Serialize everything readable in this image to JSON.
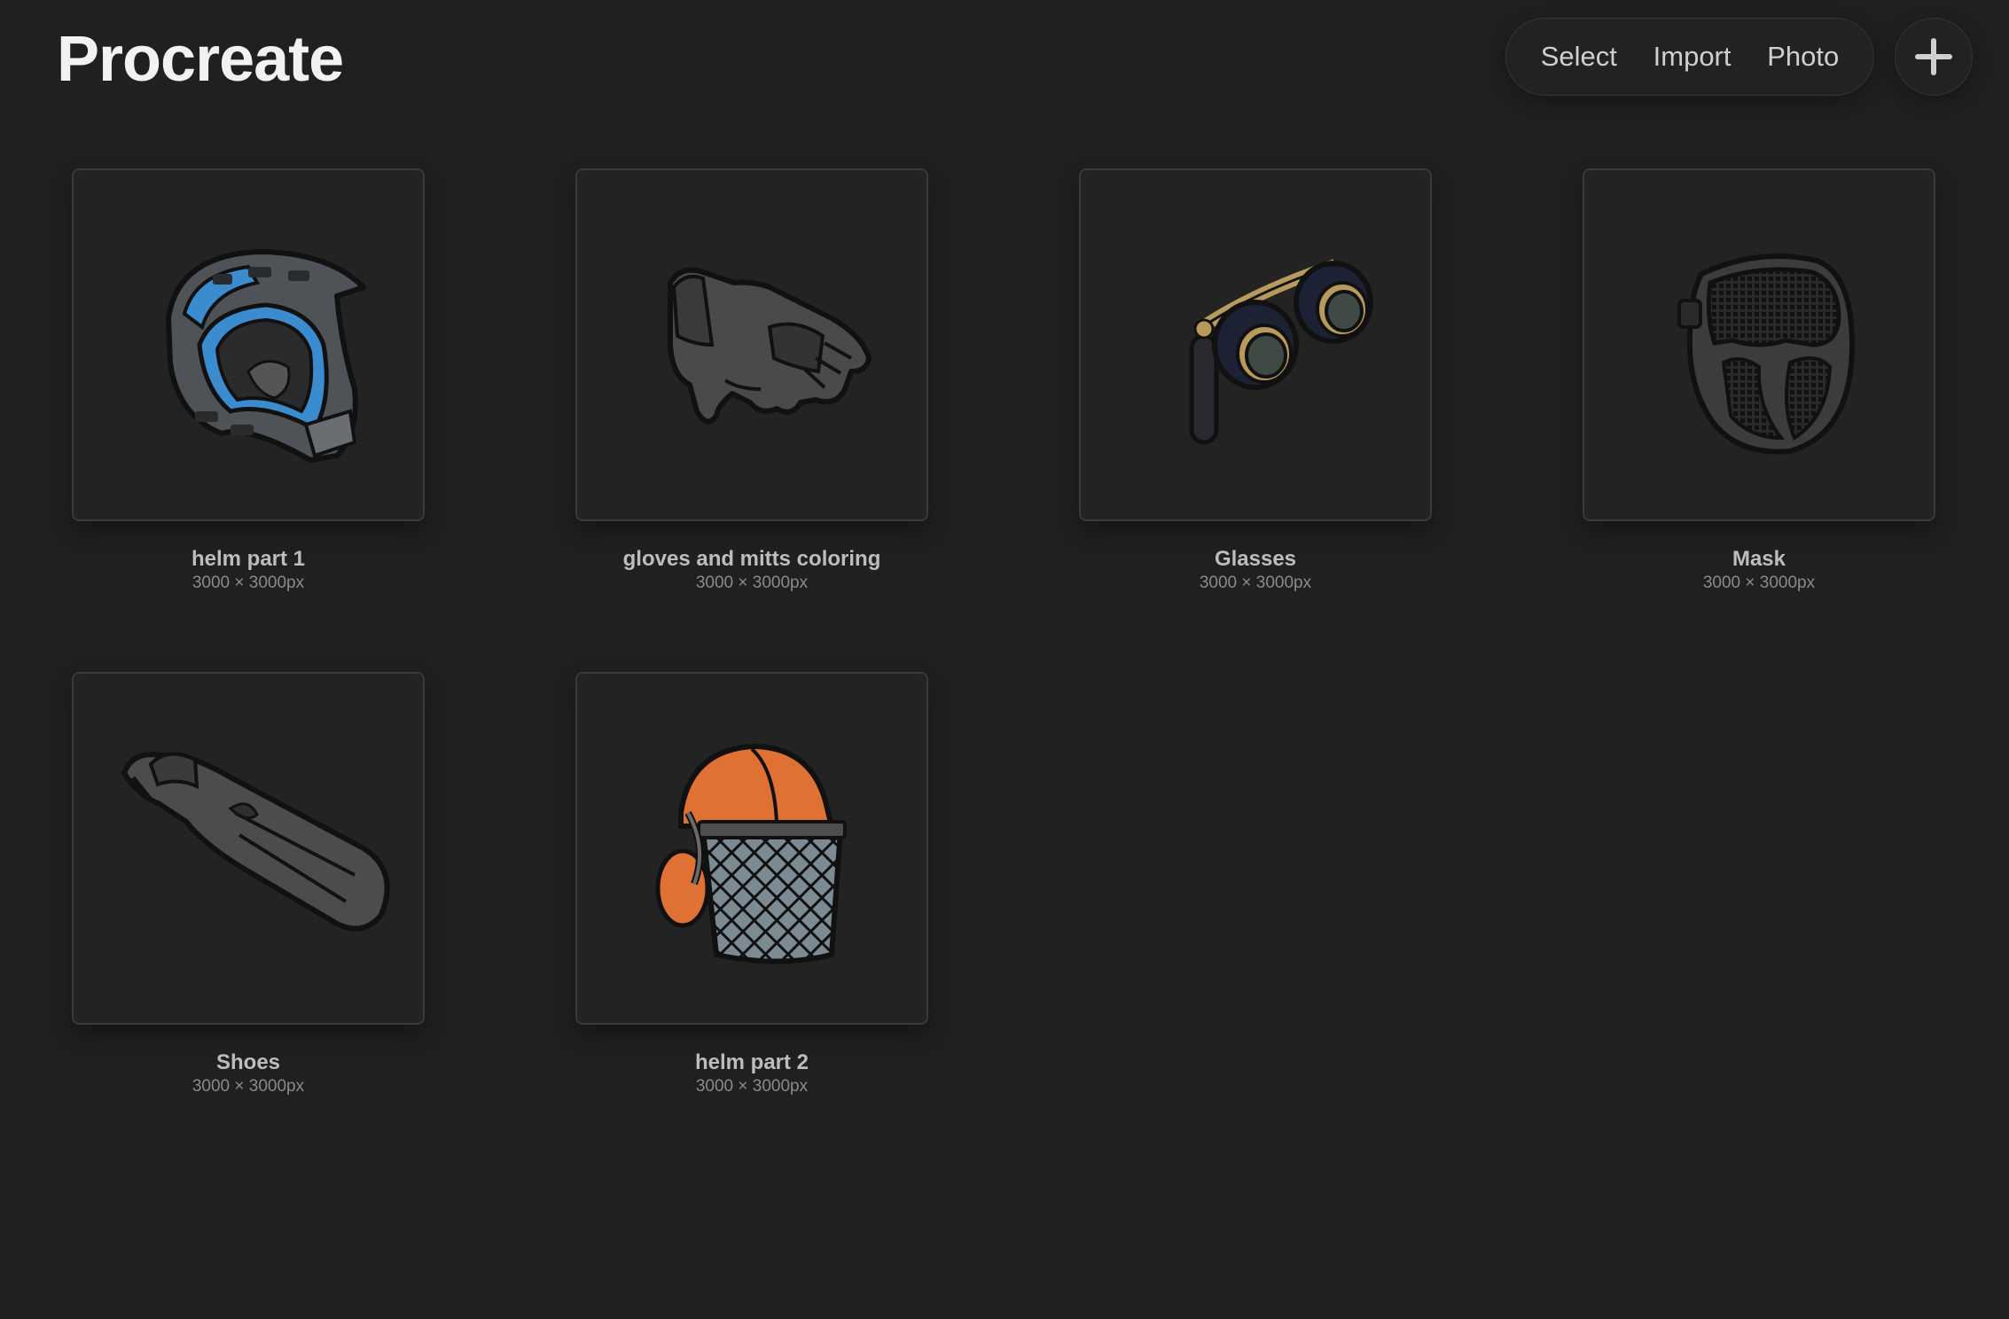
{
  "app": {
    "title": "Procreate"
  },
  "toolbar": {
    "select_label": "Select",
    "import_label": "Import",
    "photo_label": "Photo",
    "add_icon": "plus-icon"
  },
  "gallery": {
    "artworks": [
      {
        "title": "helm part 1",
        "size": "3000 × 3000px",
        "thumbnail": "full-face-bike-helmet",
        "accent": "#3b8ccf"
      },
      {
        "title": "gloves and mitts coloring",
        "size": "3000 × 3000px",
        "thumbnail": "fingerless-glove",
        "accent": "#4a4a4a"
      },
      {
        "title": "Glasses",
        "size": "3000 × 3000px",
        "thumbnail": "opera-glasses",
        "accent": "#b89a5a"
      },
      {
        "title": "Mask",
        "size": "3000 × 3000px",
        "thumbnail": "paintball-mask",
        "accent": "#3c3c3e"
      },
      {
        "title": "Shoes",
        "size": "3000 × 3000px",
        "thumbnail": "swim-fin",
        "accent": "#4a4d4a"
      },
      {
        "title": "helm part 2",
        "size": "3000 × 3000px",
        "thumbnail": "forestry-helmet",
        "accent": "#e07135"
      }
    ]
  },
  "colors": {
    "background": "#202020",
    "card_border": "#3a3a3a",
    "title_text": "#bdbdbd",
    "meta_text": "#8a8a8a"
  }
}
